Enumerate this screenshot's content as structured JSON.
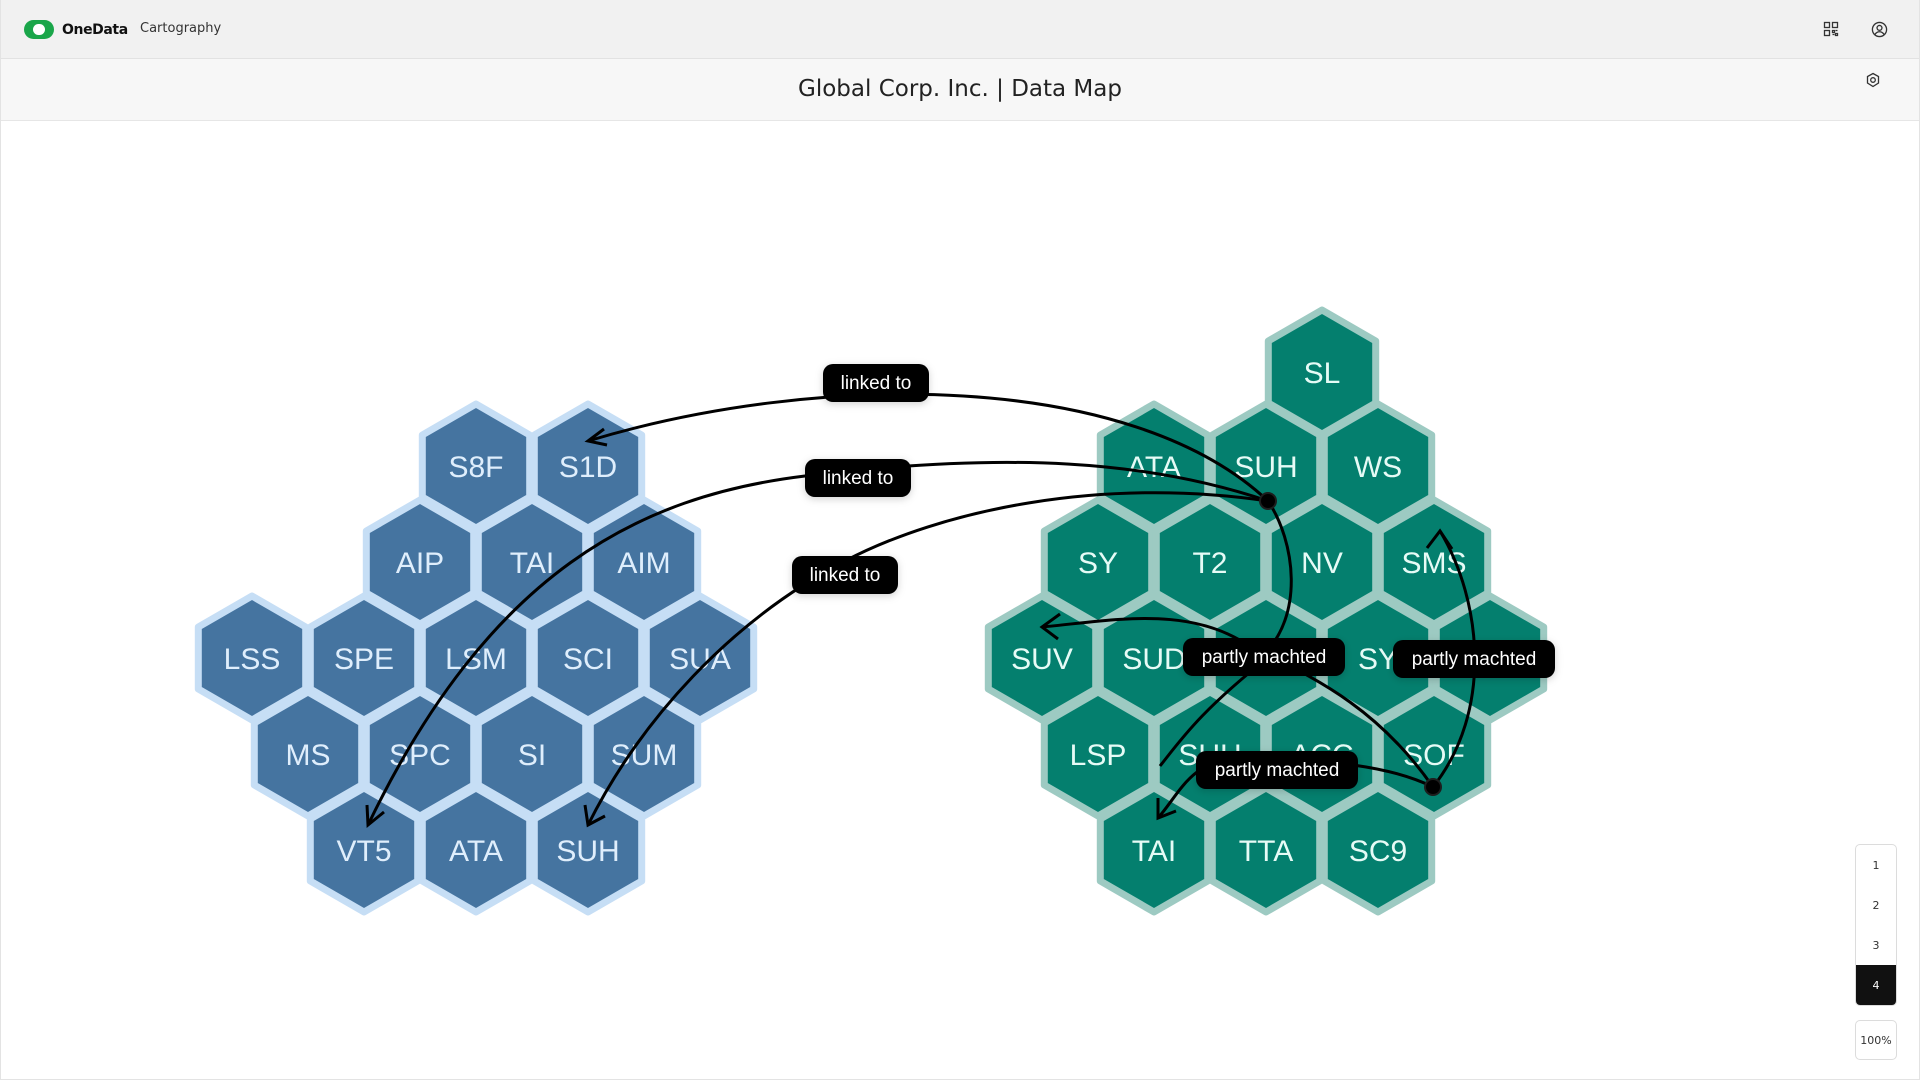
{
  "header": {
    "brand": "OneData",
    "app_name": "Cartography"
  },
  "page": {
    "title": "Global Corp. Inc. | Data Map"
  },
  "icons": {
    "qr": "qr-code-icon",
    "user": "user-circle-icon",
    "settings": "settings-gear-icon"
  },
  "colors": {
    "blue_cluster": "#4574a0",
    "blue_border": "#c6def5",
    "green_cluster": "#047f6e",
    "green_border": "#9dcac2",
    "edge_label_bg": "#000000",
    "brand_green": "#1aa64a"
  },
  "clusters": {
    "left": [
      "S8F",
      "S1D",
      "AIP",
      "TAI",
      "AIM",
      "LSS",
      "SPE",
      "LSM",
      "SCI",
      "SUA",
      "MS",
      "SPC",
      "SI",
      "SUM",
      "VT5",
      "ATA",
      "SUH"
    ],
    "right": [
      "SL",
      "ATA",
      "SUH",
      "WS",
      "SY",
      "T2",
      "NV",
      "SMS",
      "SUV",
      "SUD",
      "",
      "SY",
      "",
      "LSP",
      "SUH",
      "ACC",
      "SOF",
      "TAI",
      "TTA",
      "SC9"
    ]
  },
  "edges": {
    "e1": "linked to",
    "e2": "linked to",
    "e3": "linked to",
    "e4": "partly machted",
    "e5": "partly machted",
    "e6": "partly machted"
  },
  "pager": {
    "pages": [
      "1",
      "2",
      "3",
      "4"
    ],
    "active": "4"
  },
  "zoom": {
    "label": "100%"
  }
}
